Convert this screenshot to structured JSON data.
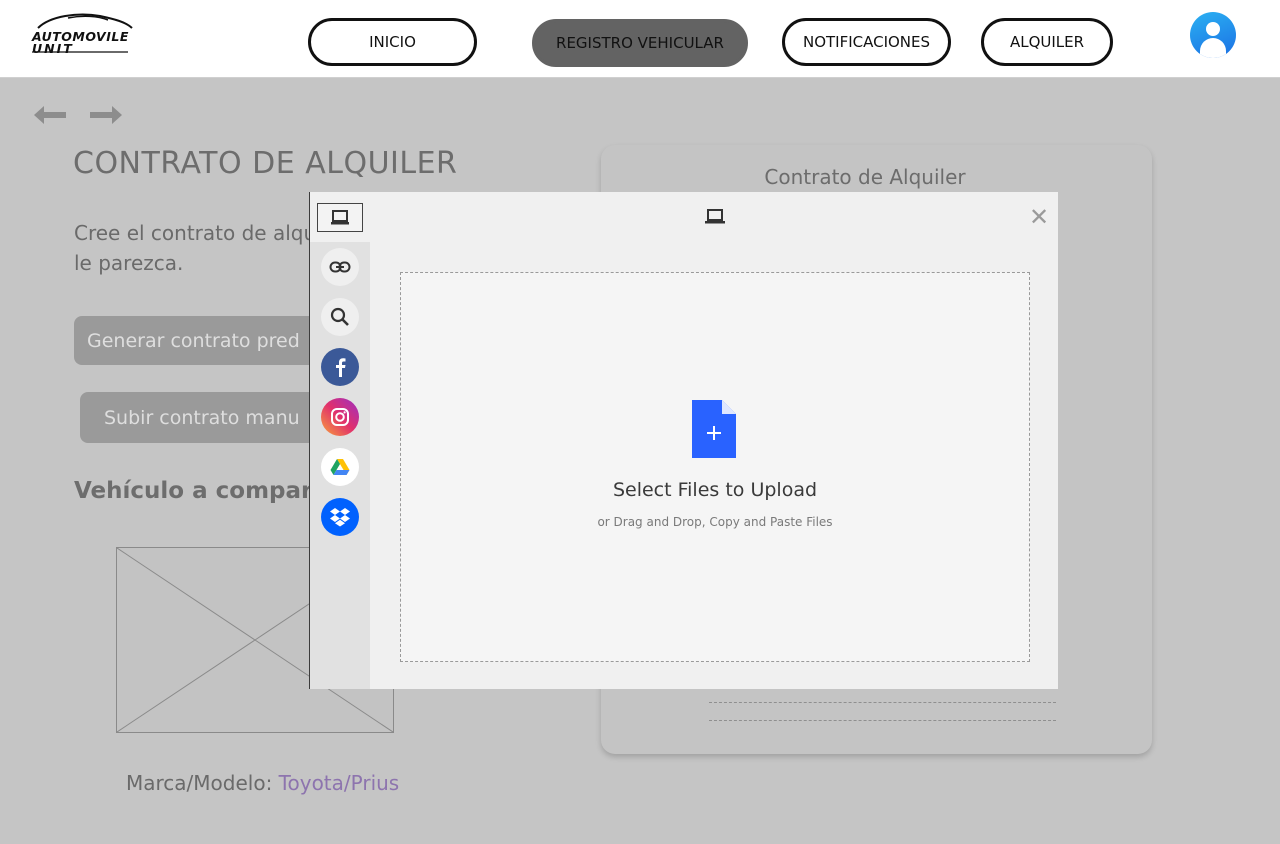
{
  "header": {
    "logo_line1": "AUTOMOVILE",
    "logo_line2": "UNIT",
    "nav": [
      {
        "label": "INICIO",
        "active": false
      },
      {
        "label": "REGISTRO VEHICULAR",
        "active": true
      },
      {
        "label": "NOTIFICACIONES",
        "active": false
      },
      {
        "label": "ALQUILER",
        "active": false
      }
    ],
    "avatar_icon": "user-avatar-icon"
  },
  "page": {
    "back_icon": "arrow-left-icon",
    "forward_icon": "arrow-right-icon",
    "title": "CONTRATO DE ALQUILER",
    "description": "Cree el contrato de alqu le parezca.",
    "generate_button": "Generar contrato pred",
    "upload_button": "Subir contrato manu",
    "vehicle_heading": "Vehículo a compart",
    "brand_label": "Marca/Modelo: ",
    "brand_value": "Toyota/Prius"
  },
  "card": {
    "title": "Contrato de Alquiler"
  },
  "upload_modal": {
    "sources": [
      "my-device-icon",
      "link-icon",
      "search-icon",
      "facebook-icon",
      "instagram-icon",
      "google-drive-icon",
      "dropbox-icon"
    ],
    "close_icon": "close-icon",
    "drop_title": "Select Files to Upload",
    "drop_subtitle": "or Drag and Drop, Copy and Paste Files",
    "accent_color": "#2962ff"
  }
}
